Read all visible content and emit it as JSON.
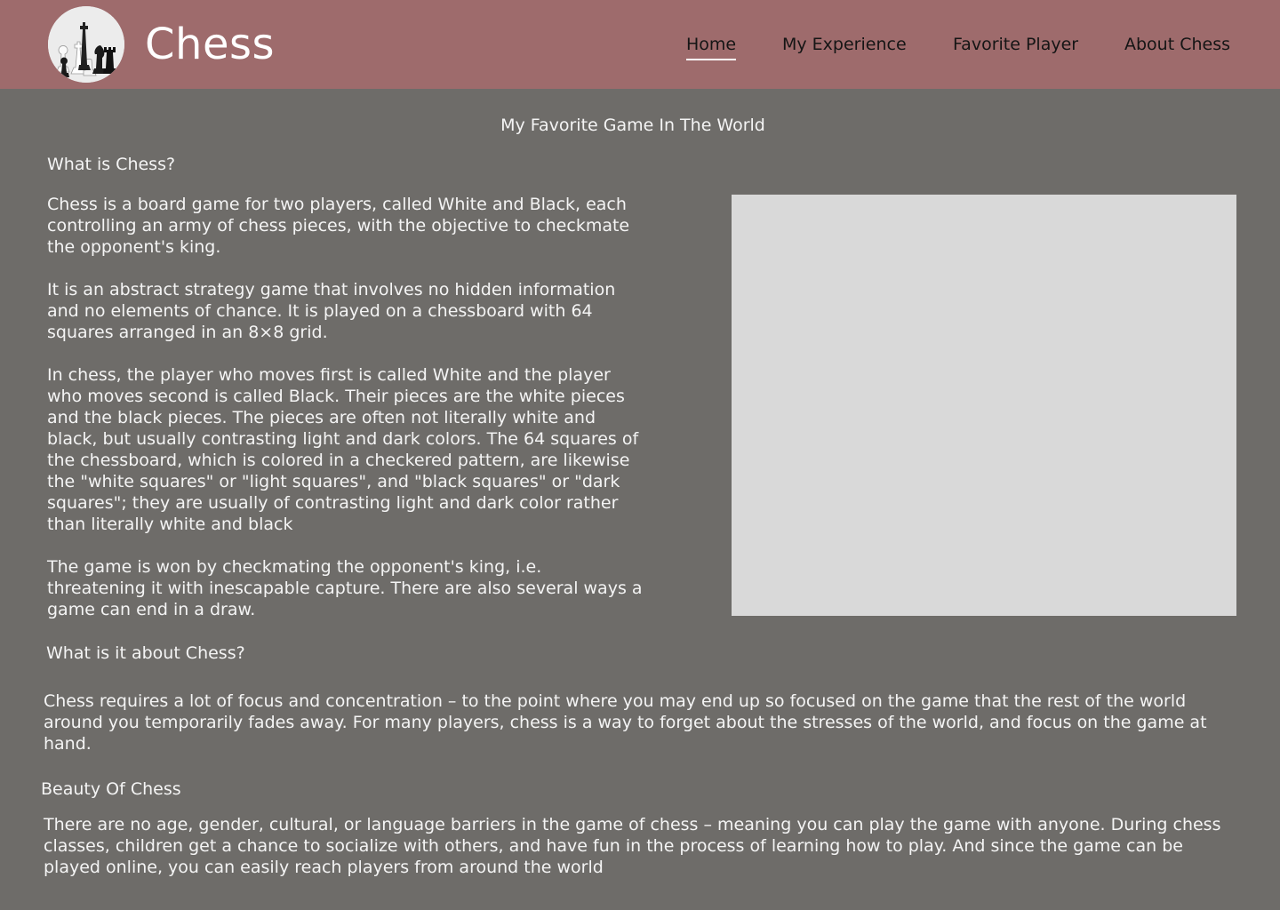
{
  "header": {
    "brand": "Chess",
    "nav": [
      {
        "label": "Home",
        "active": true
      },
      {
        "label": "My Experience",
        "active": false
      },
      {
        "label": "Favorite Player",
        "active": false
      },
      {
        "label": "About Chess",
        "active": false
      }
    ]
  },
  "main": {
    "tagline": "My Favorite Game In The World",
    "section1": {
      "heading": "What is Chess?",
      "paragraphs": [
        "Chess is a board game for two players, called White and Black, each controlling an army of chess pieces, with the objective to checkmate the opponent's king.",
        "It is an abstract strategy game that involves no hidden information and no elements of chance. It is played on a chessboard with 64 squares arranged in an 8×8 grid.",
        "In chess, the player who moves first is called White and the player who moves second is called Black. Their pieces are the white pieces and the black pieces. The pieces are often not literally white and black, but usually contrasting light and dark colors. The 64 squares of the chessboard, which is colored in a checkered pattern, are likewise the \"white squares\" or \"light squares\", and \"black squares\" or \"dark squares\"; they are usually of contrasting light and dark color rather than literally white and black",
        "The game is won by checkmating the opponent's king, i.e. threatening it with inescapable capture. There are also several ways a game can end in a draw."
      ]
    },
    "section2": {
      "heading": "What is it about Chess?",
      "paragraph": "Chess requires a lot of focus and concentration – to the point where you may end up so focused on the game that the rest of the world around you temporarily fades away. For many players, chess is a way to forget about the stresses of the world, and focus on the game at hand."
    },
    "section3": {
      "heading": "Beauty Of Chess",
      "paragraph": "There are no age, gender, cultural, or language barriers in the game of chess – meaning you can play the game with anyone. During chess classes, children get a chance to socialize with others, and have fun in the process of learning how to play. And since the game can be played online, you can easily reach players from around the world"
    }
  },
  "colors": {
    "header_bg": "#9e6b6c",
    "page_bg": "#6e6c69",
    "image_placeholder": "#d9d9d9"
  }
}
